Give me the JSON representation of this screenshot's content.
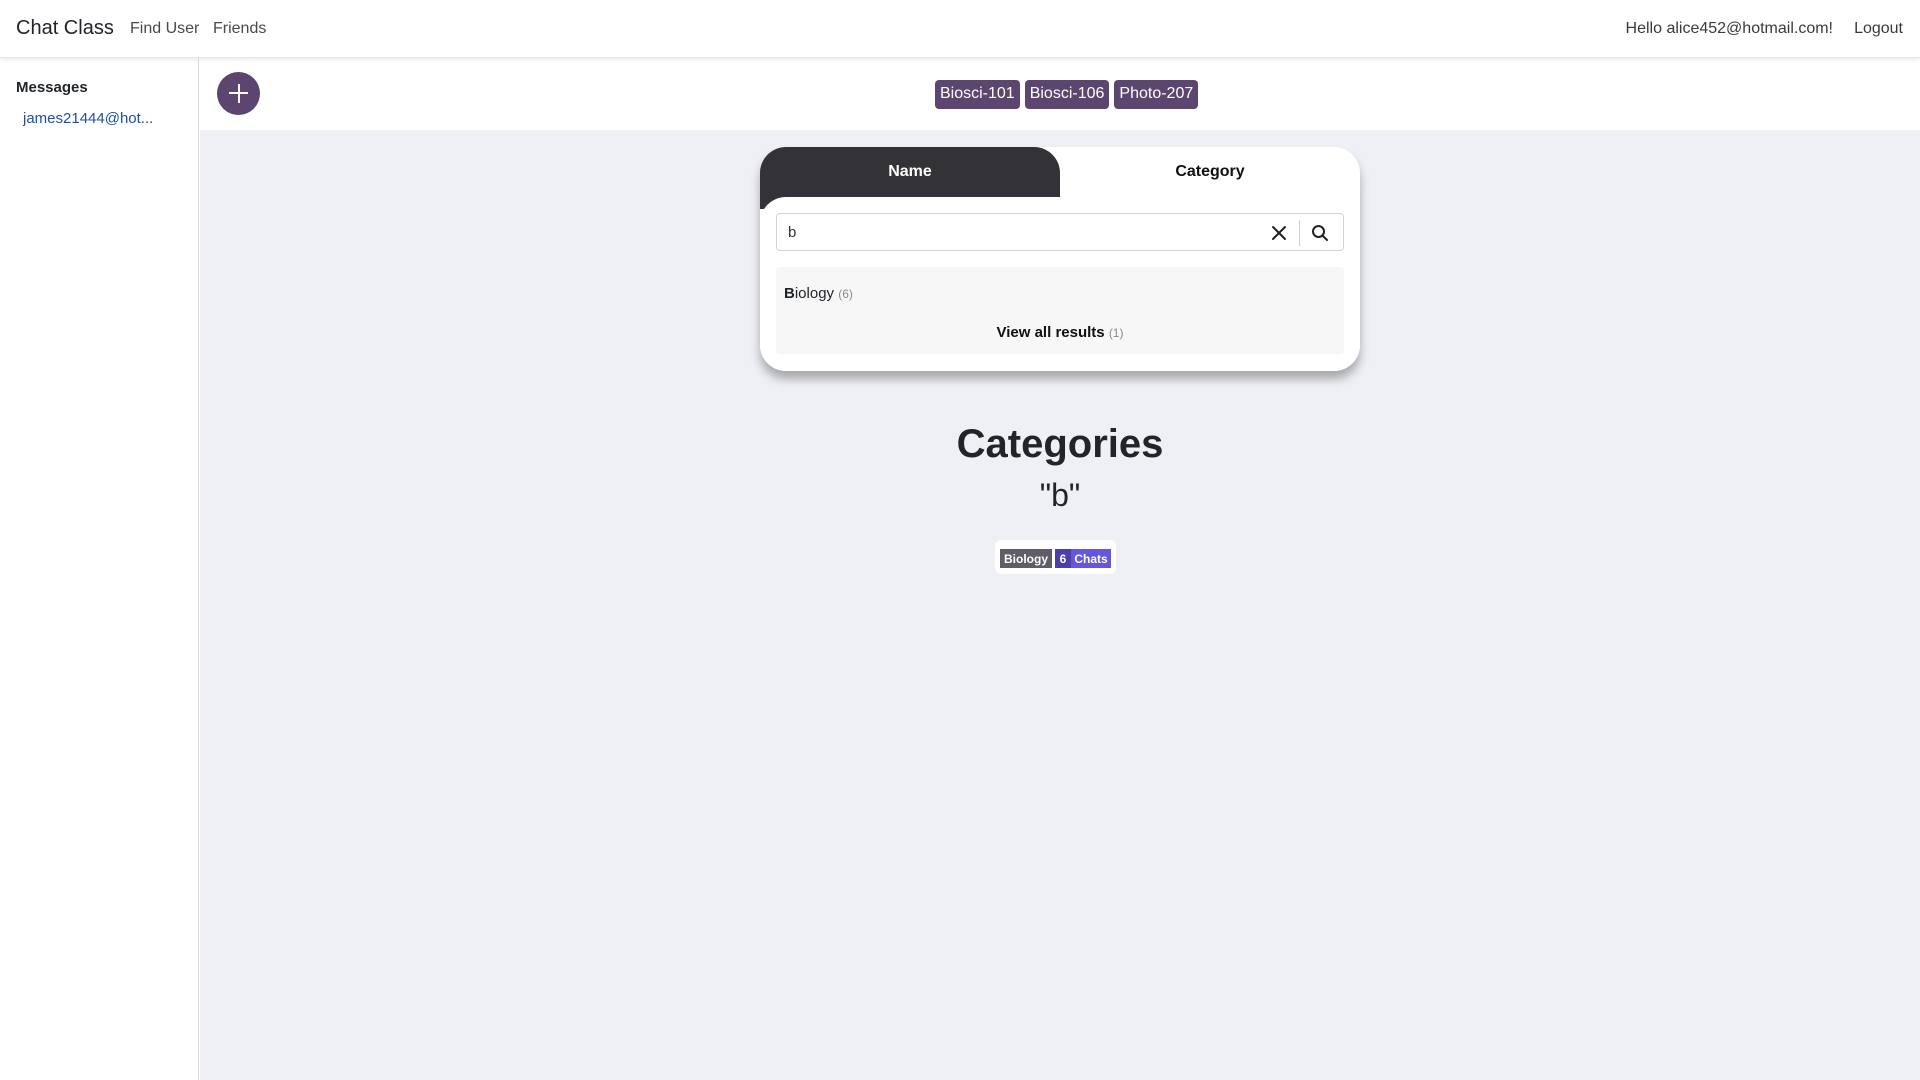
{
  "navbar": {
    "brand": "Chat Class",
    "links": [
      "Find User",
      "Friends"
    ],
    "greeting": "Hello alice452@hotmail.com!",
    "logout": "Logout"
  },
  "sidebar": {
    "heading": "Messages",
    "items": [
      {
        "label": "james21444@hot..."
      }
    ]
  },
  "topbar": {
    "add_icon": "plus-icon",
    "chips": [
      "Biosci-101",
      "Biosci-106",
      "Photo-207"
    ]
  },
  "search": {
    "tabs": {
      "name": "Name",
      "category": "Category"
    },
    "active_tab": "Name",
    "query": "b",
    "icons": {
      "clear": "close-icon",
      "search": "search-icon"
    },
    "results": [
      {
        "highlight": "B",
        "rest": "iology",
        "count": "(6)"
      }
    ],
    "view_all": {
      "label": "View all results",
      "count": "(1)"
    }
  },
  "results_section": {
    "title": "Categories",
    "query_display": "\"b\"",
    "badges": [
      {
        "category": "Biology",
        "count": "6",
        "suffix": "Chats"
      }
    ]
  },
  "colors": {
    "accent": "#5c4670",
    "tab_dark": "#333236",
    "link": "#1f4fa3",
    "main_bg": "#eff0f5",
    "badge_gray": "#5e5d68",
    "badge_count": "#4d3ea8",
    "badge_chats": "#6557d9"
  }
}
